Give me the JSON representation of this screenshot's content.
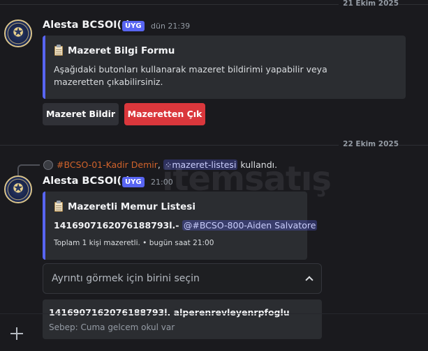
{
  "dates": {
    "first": "21 Ekim 2025",
    "second": "22 Ekim 2025"
  },
  "message1": {
    "author": "Alesta BCSOI(-)",
    "tag": "UYG",
    "time": "dün 21:39",
    "embed": {
      "icon": "clipboard-icon",
      "title": "Mazeret Bilgi Formu",
      "description": "Aşağıdaki butonları kullanarak mazeret bildirimi yapabilir veya mazeretten çıkabilirsiniz."
    },
    "buttons": {
      "report": "Mazeret Bildir",
      "exit": "Mazeretten Çık"
    }
  },
  "reply": {
    "user": "#BCSO-01-Kadir Demir",
    "separator": ",",
    "command": "mazeret-listesi",
    "suffix": "kullandı."
  },
  "message2": {
    "author": "Alesta BCSOI(-)",
    "tag": "UYG",
    "time": "21:00",
    "embed": {
      "icon": "clipboard-icon",
      "title": "Mazeretli Memur Listesi",
      "entry_id": "1416907162076188793l.-",
      "entry_mention": "@#BCSO-800-Aiden Salvatore",
      "footer": "Toplam 1 kişi mazeretli. • bugün saat 21:00"
    },
    "select": {
      "placeholder": "Ayrıntı görmek için birini seçin"
    },
    "option": {
      "title": "1416907162076188793l. alperenrevleyenrpfoglu",
      "description": "Sebep: Cuma gelcem okul var"
    }
  },
  "watermark": {
    "text": "itemsatış"
  },
  "colors": {
    "accent": "#5865f2",
    "danger": "#da373c",
    "background": "#1a1a1e"
  }
}
